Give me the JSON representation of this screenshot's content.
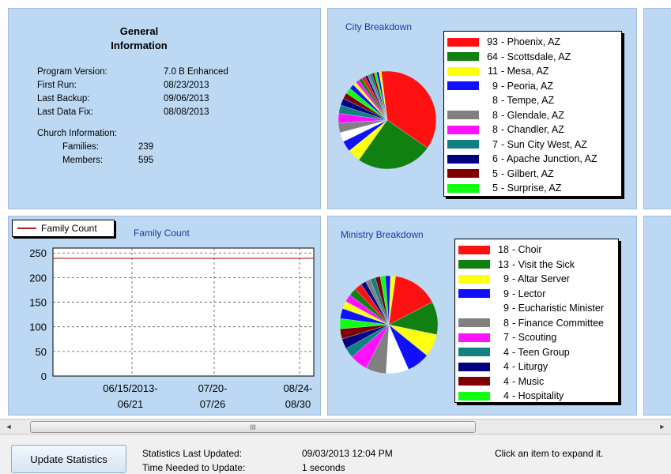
{
  "general": {
    "title_line1": "General",
    "title_line2": "Information",
    "rows": [
      {
        "label": "Program Version:",
        "value": "7.0 B Enhanced"
      },
      {
        "label": "First Run:",
        "value": "08/23/2013"
      },
      {
        "label": "Last Backup:",
        "value": "09/06/2013"
      },
      {
        "label": "Last Data Fix:",
        "value": "08/08/2013"
      }
    ],
    "church_label": "Church Information:",
    "church_rows": [
      {
        "label": "Families:",
        "value": "239"
      },
      {
        "label": "Members:",
        "value": "595"
      }
    ]
  },
  "city": {
    "title": "City Breakdown",
    "items": [
      {
        "count": "93",
        "label": "- Phoenix, AZ",
        "color": "#ff1010"
      },
      {
        "count": "64",
        "label": "- Scottsdale, AZ",
        "color": "#108010"
      },
      {
        "count": "11",
        "label": "- Mesa, AZ",
        "color": "#ffff10"
      },
      {
        "count": "9",
        "label": "- Peoria, AZ",
        "color": "#1010ff"
      },
      {
        "count": "8",
        "label": "- Tempe, AZ",
        "color": "#ffffff"
      },
      {
        "count": "8",
        "label": "- Glendale, AZ",
        "color": "#808080"
      },
      {
        "count": "8",
        "label": "- Chandler, AZ",
        "color": "#ff10ff"
      },
      {
        "count": "7",
        "label": "- Sun City West, AZ",
        "color": "#108080"
      },
      {
        "count": "6",
        "label": "- Apache Junction, AZ",
        "color": "#000080"
      },
      {
        "count": "5",
        "label": "- Gilbert, AZ",
        "color": "#800000"
      },
      {
        "count": "5",
        "label": "- Surprise, AZ",
        "color": "#10ff10"
      }
    ]
  },
  "family": {
    "legend_label": "Family Count",
    "title": "Family Count"
  },
  "ministry": {
    "title": "Ministry Breakdown",
    "items": [
      {
        "count": "18",
        "label": "- Choir",
        "color": "#ff1010"
      },
      {
        "count": "13",
        "label": "- Visit the Sick",
        "color": "#108010"
      },
      {
        "count": "9",
        "label": "- Altar Server",
        "color": "#ffff10"
      },
      {
        "count": "9",
        "label": "- Lector",
        "color": "#1010ff"
      },
      {
        "count": "9",
        "label": "- Eucharistic Minister",
        "color": "#ffffff"
      },
      {
        "count": "8",
        "label": "- Finance Committee",
        "color": "#808080"
      },
      {
        "count": "7",
        "label": "- Scouting",
        "color": "#ff10ff"
      },
      {
        "count": "4",
        "label": "- Teen Group",
        "color": "#108080"
      },
      {
        "count": "4",
        "label": "- Liturgy",
        "color": "#000080"
      },
      {
        "count": "4",
        "label": "- Music",
        "color": "#800000"
      },
      {
        "count": "4",
        "label": "- Hospitality",
        "color": "#10ff10"
      }
    ]
  },
  "chart_data": [
    {
      "type": "pie",
      "title": "City Breakdown",
      "categories": [
        "Phoenix, AZ",
        "Scottsdale, AZ",
        "Mesa, AZ",
        "Peoria, AZ",
        "Tempe, AZ",
        "Glendale, AZ",
        "Chandler, AZ",
        "Sun City West, AZ",
        "Apache Junction, AZ",
        "Gilbert, AZ",
        "Surprise, AZ"
      ],
      "values": [
        93,
        64,
        11,
        9,
        8,
        8,
        8,
        7,
        6,
        5,
        5
      ],
      "legend": "right"
    },
    {
      "type": "line",
      "title": "Family Count",
      "x": [
        "06/15/2013-06/21",
        "07/20-07/26",
        "08/24-08/30"
      ],
      "series": [
        {
          "name": "Family Count",
          "values": [
            239,
            239,
            239
          ]
        }
      ],
      "yticks": [
        "250",
        "200",
        "150",
        "100",
        "50",
        "0"
      ],
      "ylim": [
        0,
        260
      ],
      "grid": true,
      "legend": "top-left"
    },
    {
      "type": "pie",
      "title": "Ministry Breakdown",
      "categories": [
        "Choir",
        "Visit the Sick",
        "Altar Server",
        "Lector",
        "Eucharistic Minister",
        "Finance Committee",
        "Scouting",
        "Teen Group",
        "Liturgy",
        "Music",
        "Hospitality"
      ],
      "values": [
        18,
        13,
        9,
        9,
        9,
        8,
        7,
        4,
        4,
        4,
        4
      ],
      "legend": "right"
    }
  ],
  "line_chart": {
    "yticks": [
      "250",
      "200",
      "150",
      "100",
      "50",
      "0"
    ],
    "xlabels": [
      {
        "l1": "06/15/2013-",
        "l2": "06/21"
      },
      {
        "l1": "07/20-",
        "l2": "07/26"
      },
      {
        "l1": "08/24-",
        "l2": "08/30"
      }
    ]
  },
  "scrollbar": {
    "left_arrow": "◄",
    "right_arrow": "►",
    "grip": "III"
  },
  "status": {
    "update_button": "Update Statistics",
    "last_updated_label": "Statistics Last Updated:",
    "last_updated_value": "09/03/2013 12:04 PM",
    "time_needed_label": "Time Needed to Update:",
    "time_needed_value": "1 seconds",
    "hint": "Click an item to expand it."
  }
}
